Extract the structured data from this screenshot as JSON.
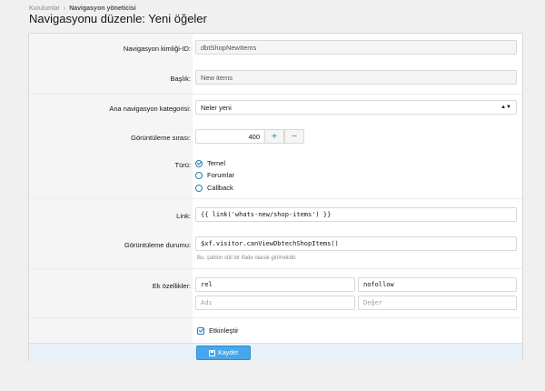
{
  "breadcrumb": {
    "items": [
      "Kurulumlar",
      "Navigasyon yöneticisi"
    ],
    "separator": "›"
  },
  "page_title": "Navigasyonu düzenle: Yeni öğeler",
  "form": {
    "nav_id": {
      "label": "Navigasyon kimliği-ID:",
      "value": "dbtShopNewItems"
    },
    "title": {
      "label": "Başlık:",
      "value": "New items"
    },
    "parent": {
      "label": "Ana navigasyon kategorisi:",
      "value": "Neler yeni"
    },
    "display_order": {
      "label": "Görüntüleme sırası:",
      "value": "400",
      "plus": "+",
      "minus": "−"
    },
    "type": {
      "label": "Türü:",
      "options": [
        {
          "label": "Temel",
          "selected": true
        },
        {
          "label": "Forumlar",
          "selected": false
        },
        {
          "label": "Callback",
          "selected": false
        }
      ]
    },
    "link": {
      "label": "Link:",
      "value": "{{ link('whats-new/shop-items') }}"
    },
    "display_condition": {
      "label": "Görüntüleme durumu:",
      "value": "$xf.visitor.canViewDbtechShopItems()",
      "hint": "Bu, şablon stili bir ifade olarak girilmelidir."
    },
    "extra_attributes": {
      "label": "Ek özellikler:",
      "rows": [
        {
          "name": "rel",
          "value": "nofollow"
        },
        {
          "name_placeholder": "Adı",
          "value_placeholder": "Değer"
        }
      ]
    },
    "enabled": {
      "label": "Etkinleştir",
      "checked": true
    }
  },
  "save_button": {
    "label": "Kaydet",
    "icon": "save-icon"
  },
  "colors": {
    "accent": "#2577b1",
    "button": "#47a7eb",
    "footer": "#e8f1f9"
  }
}
